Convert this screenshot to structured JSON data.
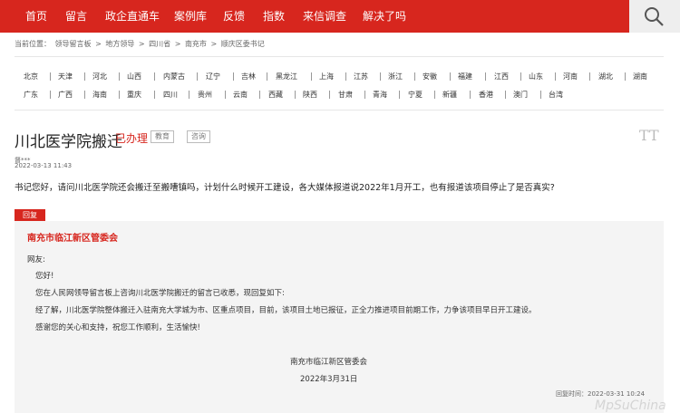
{
  "nav": {
    "items": [
      "首页",
      "留言",
      "政企直通车",
      "案例库",
      "反馈",
      "指数",
      "来信调查",
      "解决了吗"
    ]
  },
  "breadcrumb": {
    "prefix": "当前位置：",
    "items": [
      "领导留言板",
      "地方领导",
      "四川省",
      "南充市",
      "顺庆区委书记"
    ],
    "separator": ">"
  },
  "regions": {
    "row1": [
      "北京",
      "天津",
      "河北",
      "山西",
      "内蒙古",
      "辽宁",
      "吉林",
      "黑龙江",
      "上海",
      "江苏",
      "浙江",
      "安徽",
      "福建",
      "江西",
      "山东",
      "河南",
      "湖北",
      "湖南"
    ],
    "row2": [
      "广东",
      "广西",
      "海南",
      "重庆",
      "四川",
      "贵州",
      "云南",
      "西藏",
      "陕西",
      "甘肃",
      "青海",
      "宁夏",
      "新疆",
      "香港",
      "澳门",
      "台湾"
    ]
  },
  "message": {
    "title": "川北医学院搬迁",
    "status": "已办理",
    "tags": [
      "教育",
      "咨询"
    ],
    "font_toggle": "TT",
    "author": "督***",
    "time": "2022-03-13 11:43",
    "content": "书记您好，请问川北医学院还会搬迁至搬嘈镇吗，计划什么时候开工建设，各大媒体报道说2022年1月开工，也有报道该项目停止了是否真实?"
  },
  "reply": {
    "badge": "回复",
    "replier": "南充市临江新区管委会",
    "lines": [
      "网友:",
      "您好!",
      "您在人民网领导留言板上咨询川北医学院搬迁的留言已收悉，现回复如下:",
      "经了解，川北医学院整体搬迁入驻南充大学城为市、区重点项目，目前，该项目土地已报征，正全力推进项目前期工作，力争该项目早日开工建设。",
      "感谢您的关心和支持，祝您工作顺利，生活愉快!"
    ],
    "signature": "南充市临江新区管委会",
    "date": "2022年3月31日",
    "reply_time": "回复时间：2022-03-31 10:24"
  },
  "watermark": "MpSuChina"
}
